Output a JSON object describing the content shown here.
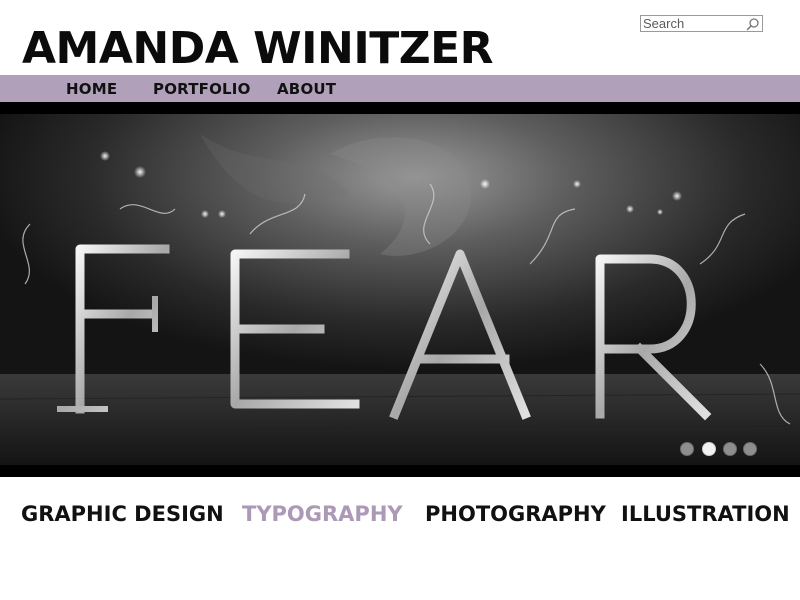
{
  "header": {
    "site_title": "AMANDA WINITZER",
    "search_placeholder": "Search"
  },
  "nav": {
    "items": [
      {
        "label": "HOME"
      },
      {
        "label": "PORTFOLIO"
      },
      {
        "label": "ABOUT"
      }
    ]
  },
  "hero": {
    "image_text": "FEAR",
    "slides_total": 4,
    "active_slide": 2
  },
  "categories": [
    {
      "label": "GRAPHIC DESIGN",
      "active": false
    },
    {
      "label": "TYPOGRAPHY",
      "active": true
    },
    {
      "label": "PHOTOGRAPHY",
      "active": false
    },
    {
      "label": "ILLUSTRATION",
      "active": false
    }
  ],
  "colors": {
    "nav_bar": "#b1a0ba",
    "active_category": "#ab99b6",
    "text": "#111111",
    "hero_background": "#000000"
  }
}
